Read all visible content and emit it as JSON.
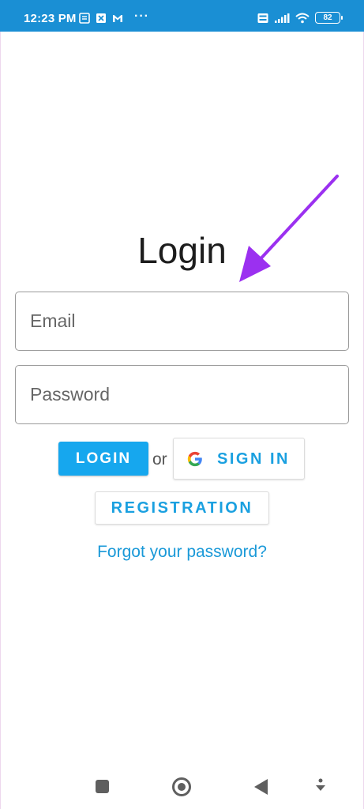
{
  "status_bar": {
    "time": "12:23 PM",
    "battery": "82",
    "left_icons": [
      "notes-icon",
      "app-icon",
      "gmail-icon"
    ],
    "overflow": "···",
    "right_icons": [
      "volte-icon",
      "signal-icon",
      "wifi-icon",
      "battery-icon"
    ],
    "background": "#1a8fd4"
  },
  "screen": {
    "title": "Login",
    "email_placeholder": "Email",
    "password_placeholder": "Password",
    "login_label": "LOGIN",
    "or_label": "or",
    "google_label": "SIGN IN",
    "registration_label": "REGISTRATION",
    "forgot_label": "Forgot your password?",
    "accent": "#16a7ee"
  },
  "annotation": {
    "icon": "arrow-icon",
    "color": "#9b30f0"
  },
  "nav_bar": {
    "buttons": [
      "recents-icon",
      "home-icon",
      "back-icon",
      "download-icon"
    ]
  }
}
